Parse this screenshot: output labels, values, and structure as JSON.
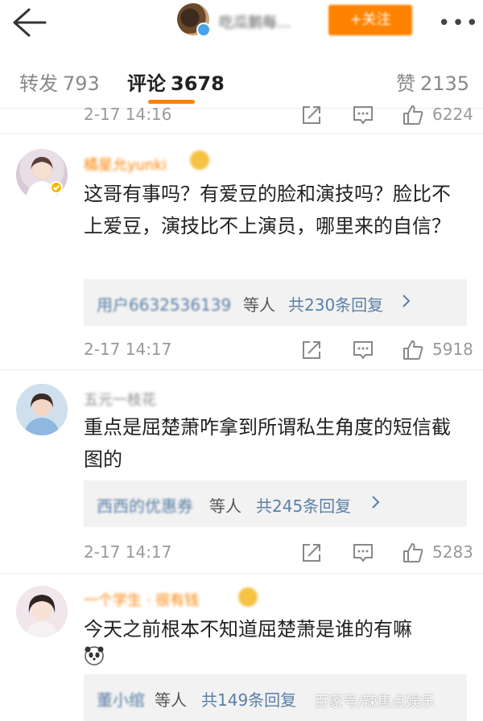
{
  "header": {
    "nickname": "吃瓜鹅每...",
    "follow_label": "+关注",
    "more_label": "•••"
  },
  "tabs": [
    {
      "label": "转发",
      "count": "793"
    },
    {
      "label": "评论",
      "count": "3678"
    },
    {
      "label": "赞",
      "count": "2135"
    }
  ],
  "active_tab": "评论",
  "colors": {
    "accent": "#ff8200",
    "link": "#5b7fa6",
    "muted": "#999999"
  },
  "prev_comment_footer": {
    "time": "2-17 14:16",
    "likes": "6224"
  },
  "comments": [
    {
      "name": "橘星允yunki",
      "text": "这哥有事吗？有爱豆的脸和演技吗？脸比不上爱豆，演技比不上演员，哪里来的自信？",
      "reply_users": "用户6632536139",
      "reply_suffix": "等人",
      "reply_count": "共230条回复",
      "time": "2-17 14:17",
      "likes": "5918"
    },
    {
      "name": "五元一枝花",
      "text": "重点是屈楚萧咋拿到所谓私生角度的短信截图的",
      "reply_users": "西西的优惠券",
      "reply_suffix": "等人",
      "reply_count": "共245条回复",
      "time": "2-17 14:17",
      "likes": "5283"
    },
    {
      "name": "一个学生 · 很有钱",
      "text": "今天之前根本不知道屈楚萧是谁的有嘛",
      "reply_users": "董小绾",
      "reply_suffix": "等人",
      "reply_count": "共149条回复"
    }
  ],
  "icons": {
    "back": "back-arrow-icon",
    "repost": "repost-icon",
    "comment": "comment-icon",
    "like": "like-icon",
    "chevron": "chevron-right-icon",
    "emoji": "panda-emoji-icon"
  },
  "watermark": "百家号/辣焦点娱乐"
}
